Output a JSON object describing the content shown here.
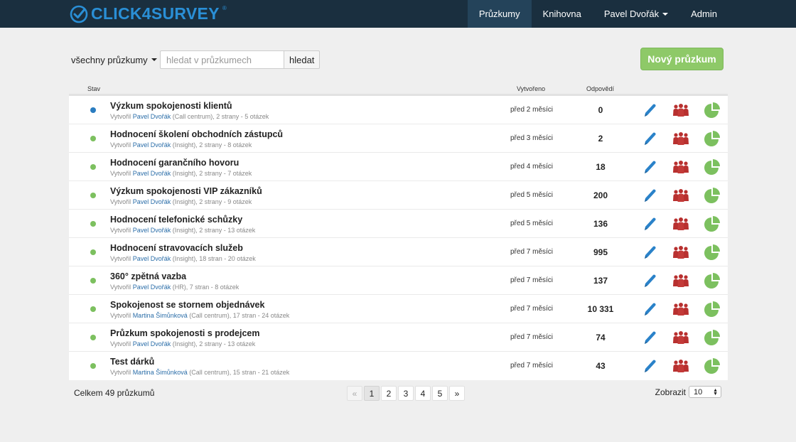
{
  "app": {
    "logo_text": "CLICK4SURVEY",
    "logo_mark": "®"
  },
  "nav": {
    "items": [
      {
        "label": "Průzkumy",
        "active": true
      },
      {
        "label": "Knihovna",
        "active": false
      },
      {
        "label": "Pavel Dvořák",
        "active": false,
        "dropdown": true
      },
      {
        "label": "Admin",
        "active": false
      }
    ]
  },
  "toolbar": {
    "filter_label": "všechny průzkumy",
    "search_placeholder": "hledat v průzkumech",
    "search_value": "",
    "search_button": "hledat",
    "new_survey_button": "Nový průzkum"
  },
  "table": {
    "headers": {
      "status": "Stav",
      "created": "Vytvořeno",
      "responses": "Odpovědí"
    },
    "rows": [
      {
        "status_color": "#2a7cc0",
        "title": "Výzkum spokojenosti klientů",
        "meta_prefix": "Vytvořil",
        "author": "Pavel Dvořák",
        "meta_suffix": "(Call centrum), 2 strany - 5 otázek",
        "created": "před 2 měsíci",
        "responses": "0"
      },
      {
        "status_color": "#7cc05f",
        "title": "Hodnocení školení obchodních zástupců",
        "meta_prefix": "Vytvořil",
        "author": "Pavel Dvořák",
        "meta_suffix": "(Insight), 2 strany - 8 otázek",
        "created": "před 3 měsíci",
        "responses": "2"
      },
      {
        "status_color": "#7cc05f",
        "title": "Hodnocení garančního hovoru",
        "meta_prefix": "Vytvořil",
        "author": "Pavel Dvořák",
        "meta_suffix": "(Insight), 2 strany - 7 otázek",
        "created": "před 4 měsíci",
        "responses": "18"
      },
      {
        "status_color": "#7cc05f",
        "title": "Výzkum spokojenosti VIP zákazníků",
        "meta_prefix": "Vytvořil",
        "author": "Pavel Dvořák",
        "meta_suffix": "(Insight), 2 strany - 9 otázek",
        "created": "před 5 měsíci",
        "responses": "200"
      },
      {
        "status_color": "#7cc05f",
        "title": "Hodnocení telefonické schůzky",
        "meta_prefix": "Vytvořil",
        "author": "Pavel Dvořák",
        "meta_suffix": "(Insight), 2 strany - 13 otázek",
        "created": "před 5 měsíci",
        "responses": "136"
      },
      {
        "status_color": "#7cc05f",
        "title": "Hodnocení stravovacích služeb",
        "meta_prefix": "Vytvořil",
        "author": "Pavel Dvořák",
        "meta_suffix": "(Insight), 18 stran - 20 otázek",
        "created": "před 7 měsíci",
        "responses": "995"
      },
      {
        "status_color": "#7cc05f",
        "title": "360° zpětná vazba",
        "meta_prefix": "Vytvořil",
        "author": "Pavel Dvořák",
        "meta_suffix": "(HR), 7 stran - 8 otázek",
        "created": "před 7 měsíci",
        "responses": "137"
      },
      {
        "status_color": "#7cc05f",
        "title": "Spokojenost se stornem objednávek",
        "meta_prefix": "Vytvořil",
        "author": "Martina Šimůnková",
        "meta_suffix": "(Call centrum), 17 stran - 24 otázek",
        "created": "před 7 měsíci",
        "responses": "10 331"
      },
      {
        "status_color": "#7cc05f",
        "title": "Průzkum spokojenosti s prodejcem",
        "meta_prefix": "Vytvořil",
        "author": "Pavel Dvořák",
        "meta_suffix": "(Insight), 2 strany - 13 otázek",
        "created": "před 7 měsíci",
        "responses": "74"
      },
      {
        "status_color": "#7cc05f",
        "title": "Test dárků",
        "meta_prefix": "Vytvořil",
        "author": "Martina Šimůnková",
        "meta_suffix": "(Call centrum), 15 stran - 21 otázek",
        "created": "před 7 měsíci",
        "responses": "43"
      }
    ]
  },
  "icons": {
    "edit": "pencil-icon",
    "responses": "people-icon",
    "results": "pie-chart-icon"
  },
  "colors": {
    "nav_bg": "#1a2f3f",
    "nav_active": "#24435a",
    "brand": "#2a8fd6",
    "green": "#8ec968",
    "edit_icon": "#2a82c9",
    "people_icon": "#b8302f",
    "pie_icon": "#7cc05f"
  },
  "footer": {
    "total": "Celkem 49 průzkumů",
    "pages": [
      {
        "label": "«",
        "state": "disabled"
      },
      {
        "label": "1",
        "state": "active"
      },
      {
        "label": "2",
        "state": ""
      },
      {
        "label": "3",
        "state": ""
      },
      {
        "label": "4",
        "state": ""
      },
      {
        "label": "5",
        "state": ""
      },
      {
        "label": "»",
        "state": ""
      }
    ],
    "show_label": "Zobrazit",
    "show_value": "10"
  }
}
